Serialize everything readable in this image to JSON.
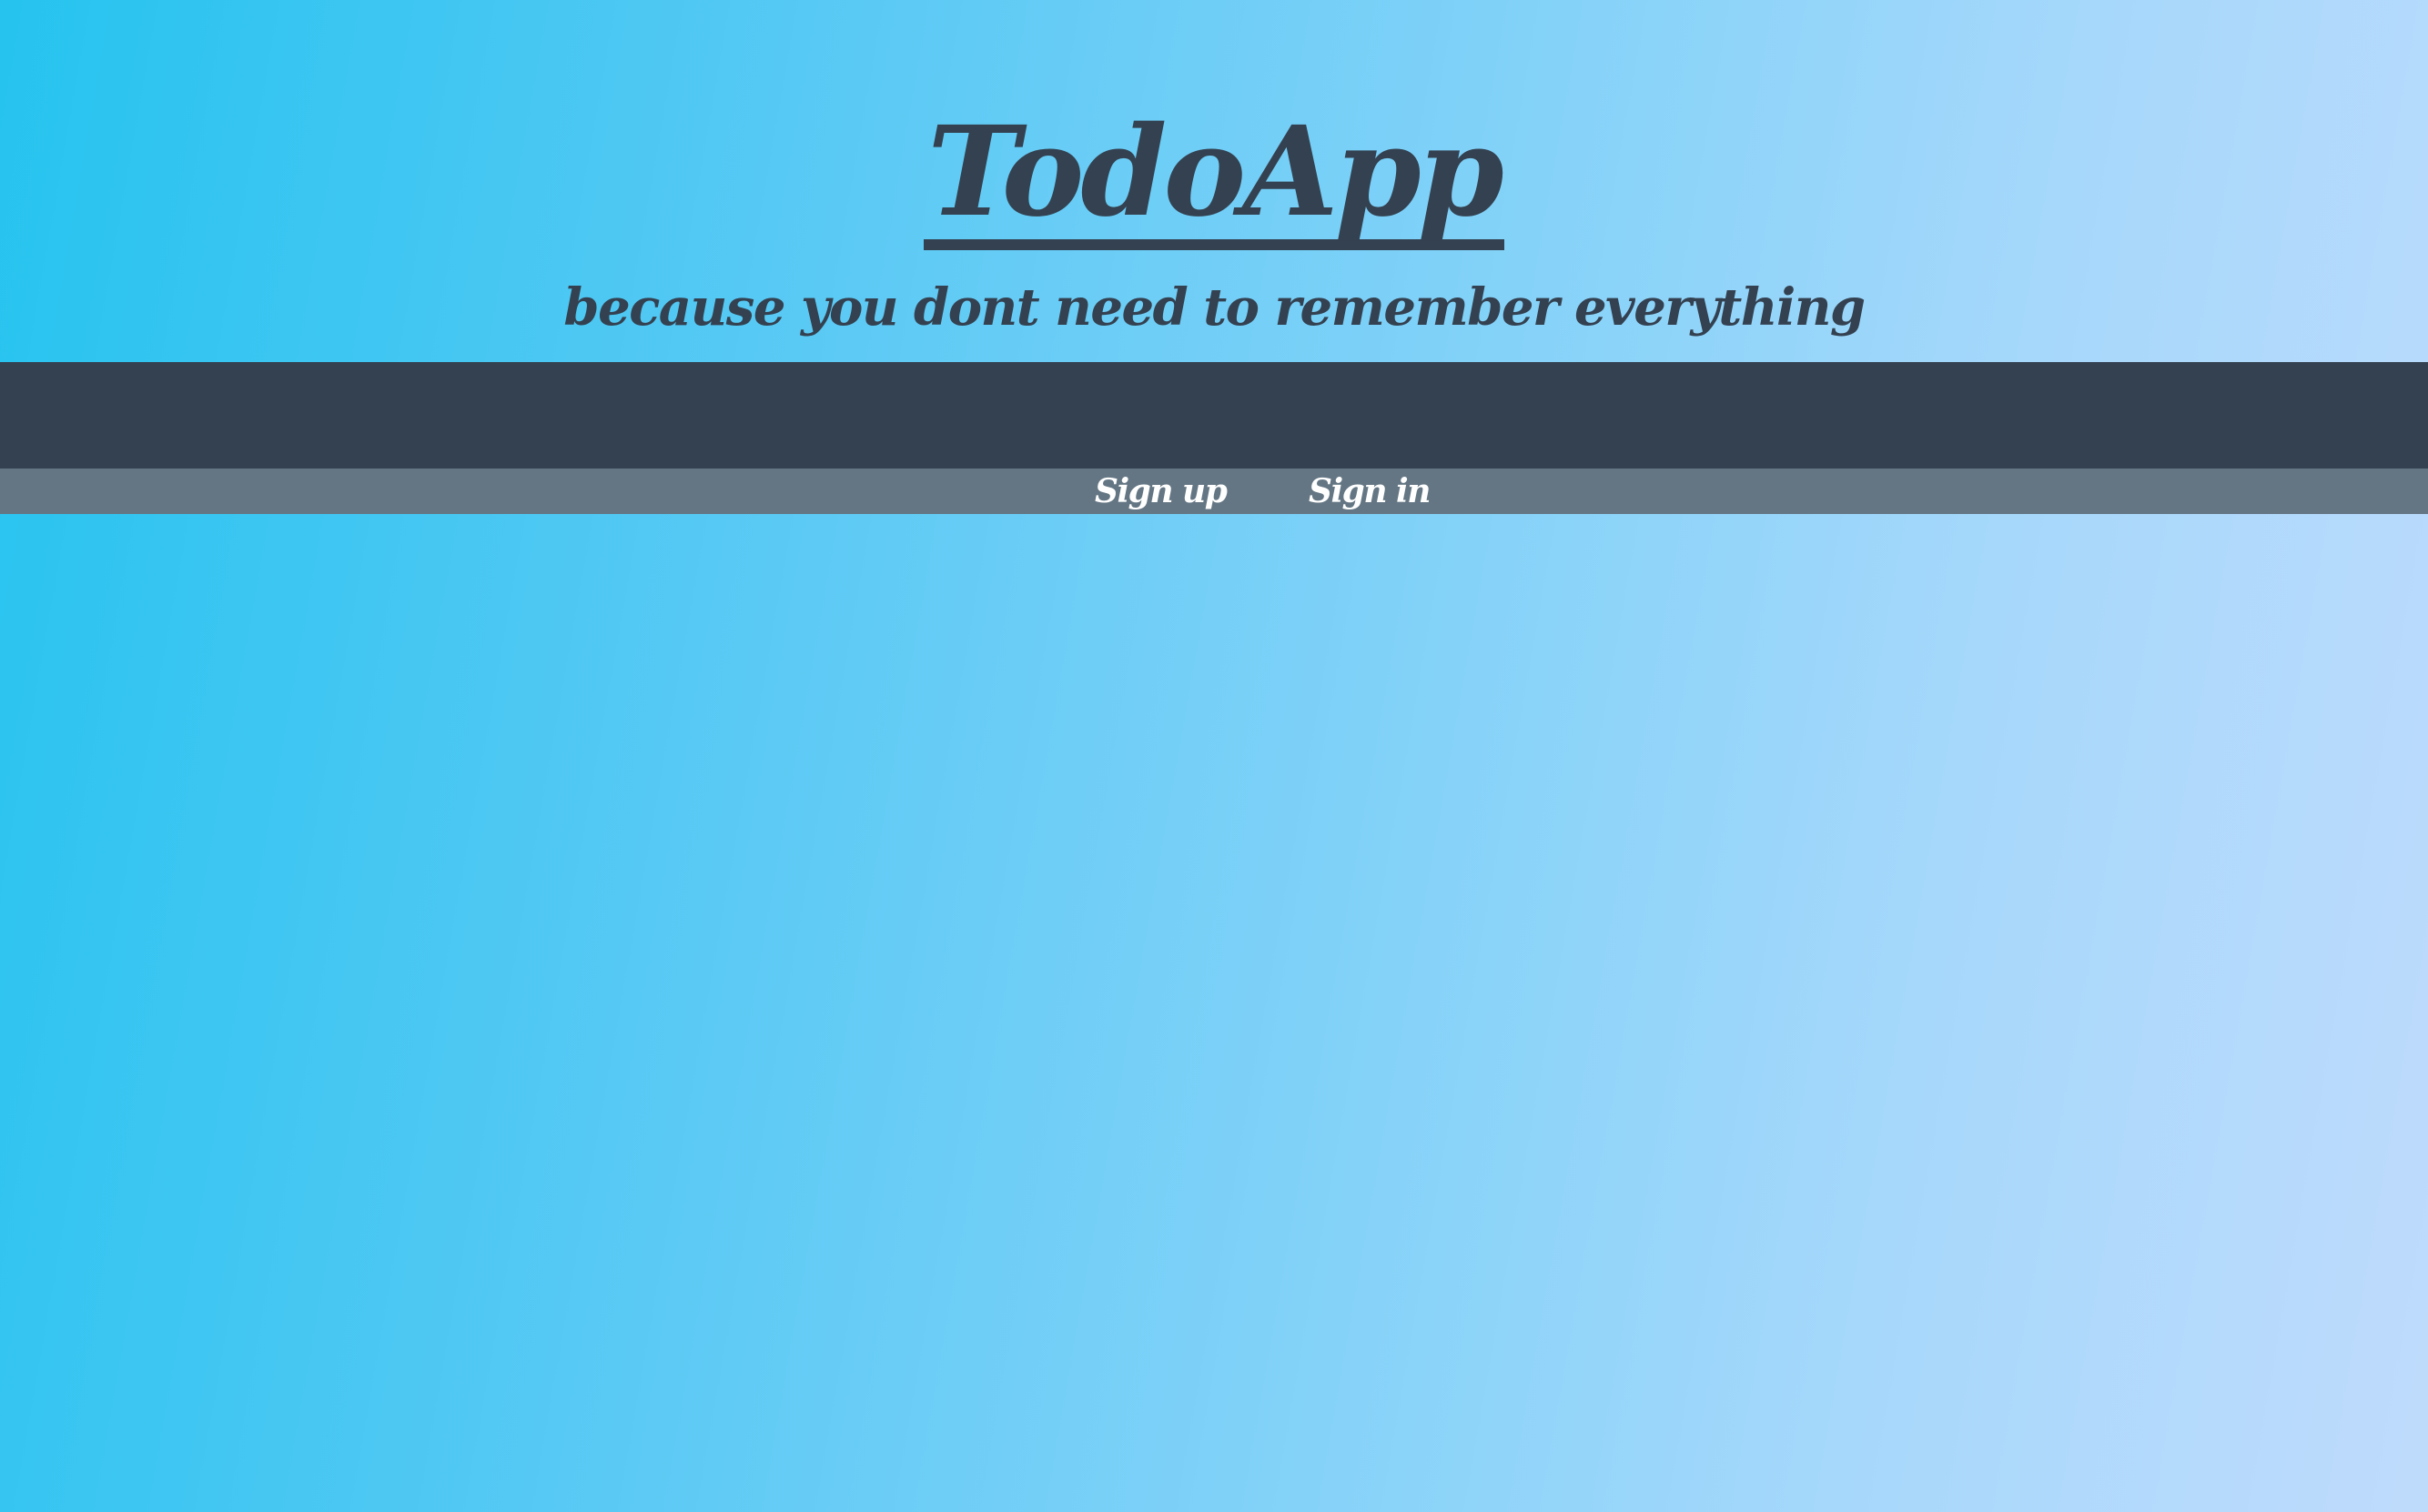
{
  "header": {
    "title": "TodoApp",
    "tagline": "because you dont need to remember everything"
  },
  "nav": {
    "signup_label": "Sign up",
    "signin_label": "Sign in"
  },
  "colors": {
    "text_dark": "#344150",
    "band_dark": "#344150",
    "nav_bar": "#647684",
    "nav_text": "#ffffff",
    "gradient_start": "#26c3ef",
    "gradient_end": "#bfdbfc"
  }
}
